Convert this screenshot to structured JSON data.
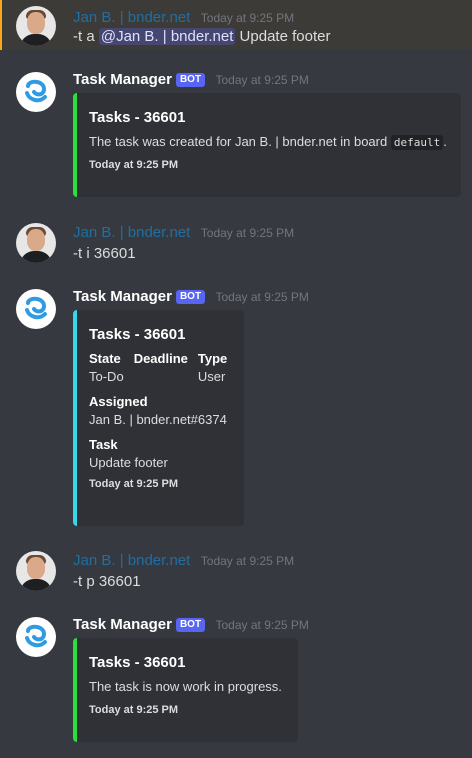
{
  "messages": [
    {
      "author": "Jan B. | bnder.net",
      "timestamp": "Today at 9:25 PM",
      "text_prefix": "-t a ",
      "mention": "@Jan B. | bnder.net",
      "text_suffix": " Update footer"
    },
    {
      "author": "Task Manager",
      "bot_tag": "BOT",
      "timestamp": "Today at 9:25 PM",
      "embed": {
        "title": "Tasks - 36601",
        "desc_prefix": "The task was created for Jan B. | bnder.net in board ",
        "desc_code": "default",
        "desc_suffix": ".",
        "footer": "Today at 9:25 PM"
      }
    },
    {
      "author": "Jan B. | bnder.net",
      "timestamp": "Today at 9:25 PM",
      "text": "-t i 36601"
    },
    {
      "author": "Task Manager",
      "bot_tag": "BOT",
      "timestamp": "Today at 9:25 PM",
      "embed": {
        "title": "Tasks - 36601",
        "fields": [
          {
            "name": "State",
            "value": "To-Do"
          },
          {
            "name": "Deadline",
            "value": ""
          },
          {
            "name": "Type",
            "value": "User"
          }
        ],
        "assigned_name": "Assigned",
        "assigned_value": "Jan B. | bnder.net#6374",
        "task_name": "Task",
        "task_value": "Update footer",
        "footer": "Today at 9:25 PM"
      }
    },
    {
      "author": "Jan B. | bnder.net",
      "timestamp": "Today at 9:25 PM",
      "text": "-t p 36601"
    },
    {
      "author": "Task Manager",
      "bot_tag": "BOT",
      "timestamp": "Today at 9:25 PM",
      "embed": {
        "title": "Tasks - 36601",
        "desc": "The task is now work in progress.",
        "footer": "Today at 9:25 PM"
      }
    }
  ],
  "colors": {
    "background": "#36393f",
    "embed_background": "#2f3136",
    "accent_green": "#2ce03b",
    "accent_cyan": "#38d6ea",
    "mention_highlight": "#faa61a",
    "bot_tag": "#5865f2"
  },
  "icons": {
    "bot_avatar": "task-manager-logo-icon",
    "user_avatar": "user-photo-avatar"
  }
}
